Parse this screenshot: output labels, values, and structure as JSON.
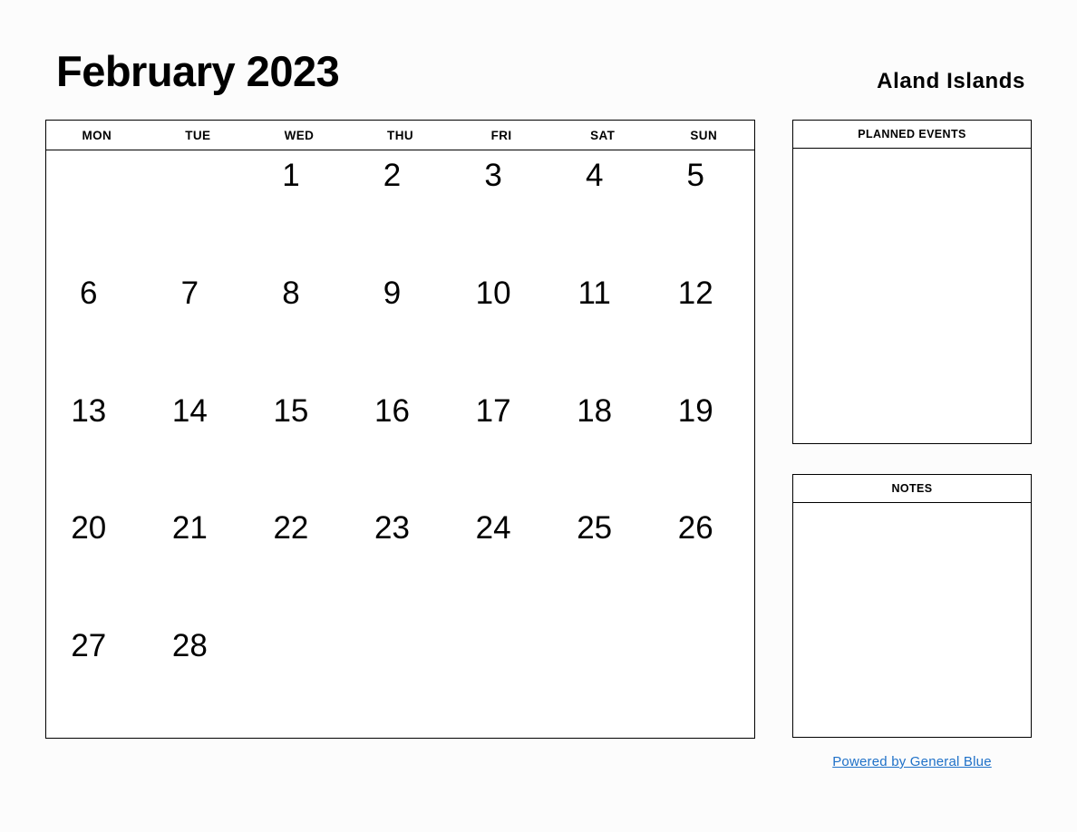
{
  "header": {
    "month_title": "February 2023",
    "region_title": "Aland Islands"
  },
  "calendar": {
    "weekdays": [
      "MON",
      "TUE",
      "WED",
      "THU",
      "FRI",
      "SAT",
      "SUN"
    ],
    "weeks": [
      [
        "",
        "",
        "1",
        "2",
        "3",
        "4",
        "5"
      ],
      [
        "6",
        "7",
        "8",
        "9",
        "10",
        "11",
        "12"
      ],
      [
        "13",
        "14",
        "15",
        "16",
        "17",
        "18",
        "19"
      ],
      [
        "20",
        "21",
        "22",
        "23",
        "24",
        "25",
        "26"
      ],
      [
        "27",
        "28",
        "",
        "",
        "",
        "",
        ""
      ]
    ]
  },
  "panels": {
    "planned_events": {
      "title": "PLANNED EVENTS",
      "content": ""
    },
    "notes": {
      "title": "NOTES",
      "content": ""
    }
  },
  "footer": {
    "link_label": "Powered by General Blue"
  },
  "colors": {
    "link": "#1f71c8",
    "border": "#000000",
    "background": "#fcfcfc",
    "text": "#000000"
  }
}
